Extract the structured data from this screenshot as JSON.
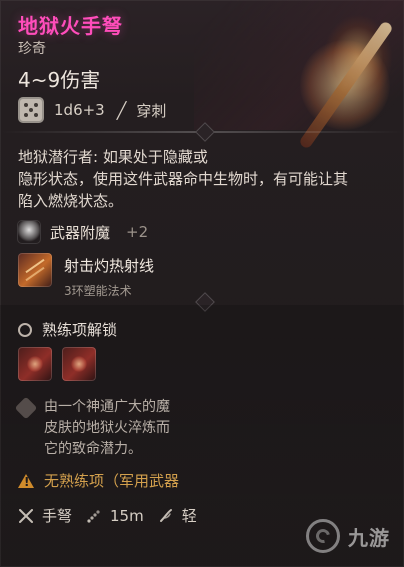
{
  "header": {
    "title": "地狱火手弩",
    "rarity": "珍奇",
    "damage": "4~9伤害",
    "damage_roll": "1d6+3",
    "damage_type": "穿刺"
  },
  "description": {
    "text": "地狱潜行者: 如果处于隐藏或\n隐形状态，使用这件武器命中生物时，有可能让其\n陷入燃烧状态。"
  },
  "enchantment": {
    "label": "武器附魔",
    "bonus": "+2"
  },
  "spell": {
    "name": "射击灼热射线",
    "sub": "3环塑能法术"
  },
  "proficiency": {
    "title": "熟练项解锁"
  },
  "lore": {
    "text": "由一个神通广大的魔\n皮肤的地狱火淬炼而\n它的致命潜力。"
  },
  "warning": {
    "text": "无熟练项（军用武器"
  },
  "stats": {
    "type": "手弩",
    "range": "15m",
    "extra": "轻"
  },
  "watermark": {
    "text": "九游"
  },
  "icons": {
    "die": "d6-die-icon",
    "pierce": "piercing-icon",
    "enchant": "enchant-icon",
    "spell": "spell-icon",
    "proficiency": "proficiency-icon",
    "lore": "lore-icon",
    "warning": "warning-icon",
    "weapon": "crossbow-icon",
    "range": "range-icon",
    "property": "feather-icon"
  },
  "colors": {
    "title": "#ff4dbb",
    "warning": "#d3a04d"
  }
}
